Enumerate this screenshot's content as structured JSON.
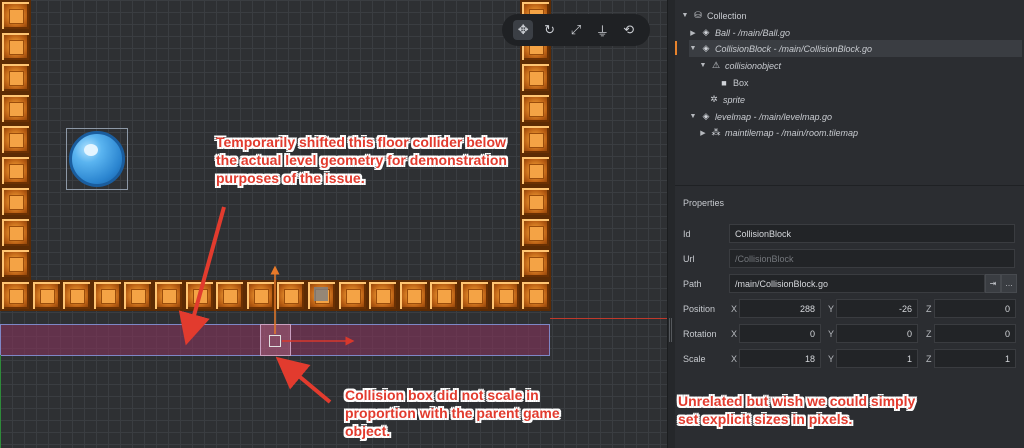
{
  "outline": {
    "items": [
      {
        "label": "Collection",
        "icon": "collection-icon",
        "italic": false
      },
      {
        "label": "Ball - /main/Ball.go",
        "icon": "game-object-icon",
        "italic": true
      },
      {
        "label": "CollisionBlock - /main/CollisionBlock.go",
        "icon": "game-object-icon",
        "italic": true,
        "selected": true
      },
      {
        "label": "collisionobject",
        "icon": "collision-object-icon",
        "italic": true
      },
      {
        "label": "Box",
        "icon": "box-shape-icon",
        "italic": false
      },
      {
        "label": "sprite",
        "icon": "sprite-icon",
        "italic": true
      },
      {
        "label": "levelmap - /main/levelmap.go",
        "icon": "game-object-icon",
        "italic": true
      },
      {
        "label": "maintilemap - /main/room.tilemap",
        "icon": "tilemap-icon",
        "italic": true
      }
    ]
  },
  "properties": {
    "title": "Properties",
    "id_label": "Id",
    "id_value": "CollisionBlock",
    "url_label": "Url",
    "url_value": "/CollisionBlock",
    "path_label": "Path",
    "path_value": "/main/CollisionBlock.go",
    "position_label": "Position",
    "position": {
      "x": "288",
      "y": "-26",
      "z": "0"
    },
    "rotation_label": "Rotation",
    "rotation": {
      "x": "0",
      "y": "0",
      "z": "0"
    },
    "scale_label": "Scale",
    "scale": {
      "x": "18",
      "y": "1",
      "z": "1"
    },
    "axis_x": "X",
    "axis_y": "Y",
    "axis_z": "Z",
    "goto_button": "⇥",
    "browse_button": "…"
  },
  "toolbar": {
    "tools": [
      "move-tool-icon",
      "rotate-tool-icon",
      "scale-tool-icon",
      "visibility-filter-icon",
      "camera-reset-icon"
    ]
  },
  "annotations": {
    "floor_note": "Temporarily shifted this floor collider below the actual level geometry for demonstration purposes of the issue.",
    "collision_note": "Collision box did not scale in proportion with the parent game object.",
    "scale_note": "Unrelated but wish we could simply set explicit sizes in pixels."
  },
  "colors": {
    "annotation_red": "#e23b2e",
    "selection_orange": "#e8832c",
    "brick_orange": "#e08a2a",
    "ball_blue": "#2a84cf",
    "collision_magenta": "#82345a"
  }
}
